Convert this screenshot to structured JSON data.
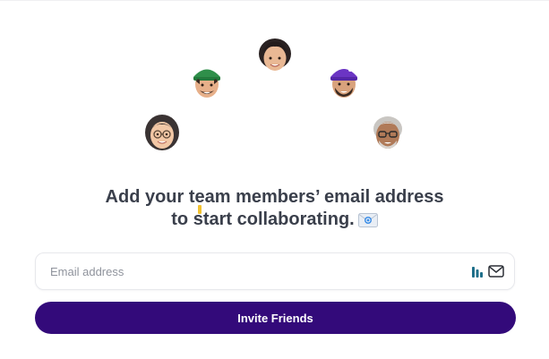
{
  "headline": {
    "line1": "Add your team members’ email address",
    "line2": "to start collaborating."
  },
  "email_field": {
    "placeholder": "Email address",
    "value": ""
  },
  "invite_button": {
    "label": "Invite Friends"
  },
  "colors": {
    "primary": "#330a7a",
    "heading_text": "#3a3f4b",
    "placeholder_text": "#8f939c",
    "input_border": "#e7e8ec"
  },
  "icons": {
    "avatars": [
      "memoji-avatar-glasses-woman",
      "memoji-avatar-green-cap",
      "memoji-avatar-curly-hair",
      "memoji-avatar-purple-cap",
      "memoji-avatar-gray-hair-glasses"
    ],
    "headline_emoji": "envelope-icon",
    "input_extension": "extension-icon",
    "input_trailing": "mail-icon"
  }
}
